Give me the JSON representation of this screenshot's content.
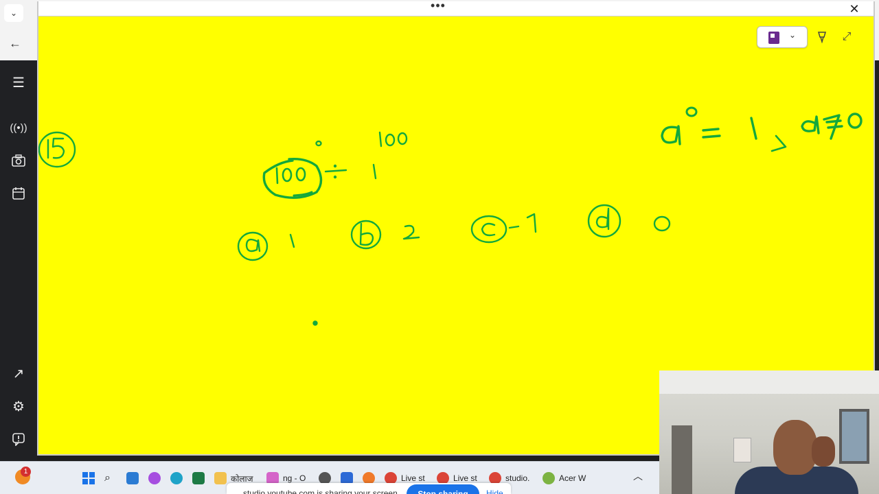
{
  "window": {
    "menu_dots": "•••",
    "close_label": "✕"
  },
  "toolbar": {
    "notebook_icon": "notebook-icon",
    "caret": "⌄",
    "pen_icon": "pen-icon",
    "expand_icon": "expand-icon"
  },
  "whiteboard": {
    "ink_color": "#14a83c",
    "background": "#ffff00",
    "question_number": "15",
    "question": "100° ÷ 100¹",
    "options": [
      {
        "letter": "a",
        "value": "1"
      },
      {
        "letter": "b",
        "value": "2"
      },
      {
        "letter": "c",
        "value": "-1"
      },
      {
        "letter": "d",
        "value": "0"
      }
    ],
    "rule": "a⁰ = 1 , a ≠ 0"
  },
  "taskbar": {
    "weather_badge": "1",
    "items": [
      {
        "label": "कोलाज"
      },
      {
        "label": "ng - O"
      },
      {
        "label": "Live st"
      },
      {
        "label": "Live st"
      },
      {
        "label": "studio."
      },
      {
        "label": "Acer W"
      }
    ],
    "share_text": "studio.youtube.com is sharing your screen.",
    "share_stop": "Stop sharing",
    "share_hide": "Hide"
  }
}
